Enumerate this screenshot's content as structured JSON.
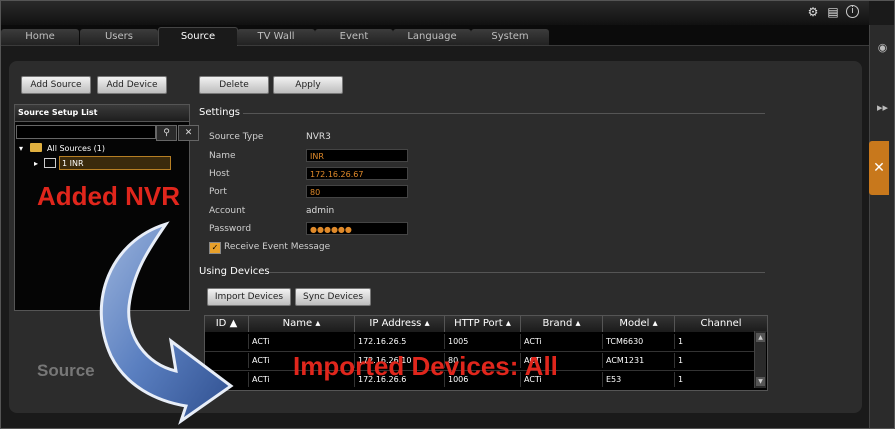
{
  "colors": {
    "accent": "#c8781c",
    "callout": "#e0261c",
    "field_text": "#e08a2a"
  },
  "topbar": {
    "icons": [
      "gear-icon",
      "document-icon",
      "info-icon"
    ]
  },
  "tabs": [
    {
      "label": "Home"
    },
    {
      "label": "Users"
    },
    {
      "label": "Source",
      "active": true
    },
    {
      "label": "TV Wall"
    },
    {
      "label": "Event"
    },
    {
      "label": "Language"
    },
    {
      "label": "System"
    }
  ],
  "toolbar": {
    "add_source": "Add Source",
    "add_device": "Add Device",
    "delete": "Delete",
    "apply": "Apply"
  },
  "source_list": {
    "title": "Source Setup List",
    "search_placeholder": "",
    "tree": {
      "root": "All Sources (1)",
      "child": "1 INR"
    }
  },
  "settings": {
    "title": "Settings",
    "source_type_label": "Source Type",
    "source_type": "NVR3",
    "name_label": "Name",
    "name": "INR",
    "host_label": "Host",
    "host": "172.16.26.67",
    "port_label": "Port",
    "port": "80",
    "account_label": "Account",
    "account": "admin",
    "password_label": "Password",
    "password": "●●●●●●",
    "receive_event_label": "Receive Event Message",
    "receive_event": true
  },
  "using_devices": {
    "title": "Using Devices",
    "import_label": "Import Devices",
    "sync_label": "Sync Devices",
    "columns": [
      "ID",
      "Name",
      "IP Address",
      "HTTP Port",
      "Brand",
      "Model",
      "Channel"
    ],
    "rows": [
      {
        "id": "",
        "name": "ACTi",
        "ip": "172.16.26.5",
        "port": "1005",
        "brand": "ACTi",
        "model": "TCM6630",
        "channel": "1"
      },
      {
        "id": "",
        "name": "ACTi",
        "ip": "172.16.26.10",
        "port": "80",
        "brand": "ACTi",
        "model": "ACM1231",
        "channel": "1"
      },
      {
        "id": "4",
        "name": "ACTi",
        "ip": "172.16.26.6",
        "port": "1006",
        "brand": "ACTi",
        "model": "E53",
        "channel": "1"
      }
    ]
  },
  "callouts": {
    "added": "Added NVR",
    "imported": "Imported Devices: All"
  },
  "ghost_text": "Source"
}
